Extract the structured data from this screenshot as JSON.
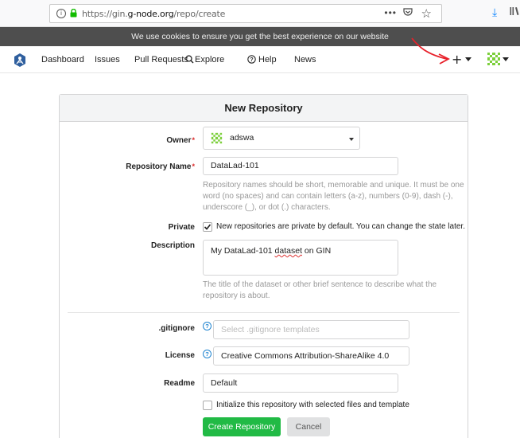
{
  "browser": {
    "url_prefix": "https://gin.",
    "url_domain": "g-node.org",
    "url_path": "/repo/create",
    "more_label": "•••"
  },
  "cookie_banner": {
    "text": "We use cookies to ensure you get the best experience on our website"
  },
  "nav": {
    "items": [
      "Dashboard",
      "Issues",
      "Pull Requests",
      "Explore",
      "Help",
      "News"
    ],
    "plus_label": "+"
  },
  "form": {
    "title": "New Repository",
    "owner": {
      "label": "Owner",
      "value": "adswa"
    },
    "repo_name": {
      "label": "Repository Name",
      "value": "DataLad-101",
      "help": "Repository names should be short, memorable and unique. It must be one word (no spaces) and can contain letters (a-z), numbers (0-9), dash (-), underscore (_), or dot (.) characters."
    },
    "private": {
      "label": "Private",
      "checked": true,
      "text": "New repositories are private by default. You can change the state later."
    },
    "description": {
      "label": "Description",
      "value_before": "My DataLad-101 ",
      "value_misspelled": "dataset",
      "value_after": " on GIN",
      "help": "The title of the dataset or other brief sentence to describe what the repository is about."
    },
    "gitignore": {
      "label": ".gitignore",
      "placeholder": "Select .gitignore templates"
    },
    "license": {
      "label": "License",
      "value": "Creative Commons Attribution-ShareAlike 4.0"
    },
    "readme": {
      "label": "Readme",
      "value": "Default"
    },
    "init": {
      "checked": false,
      "text": "Initialize this repository with selected files and template"
    },
    "create_button": "Create Repository",
    "cancel_button": "Cancel"
  },
  "colors": {
    "accent_green": "#21ba45",
    "required_red": "#db2828",
    "annotation_red": "#e8202a",
    "link_blue": "#2185d0"
  }
}
